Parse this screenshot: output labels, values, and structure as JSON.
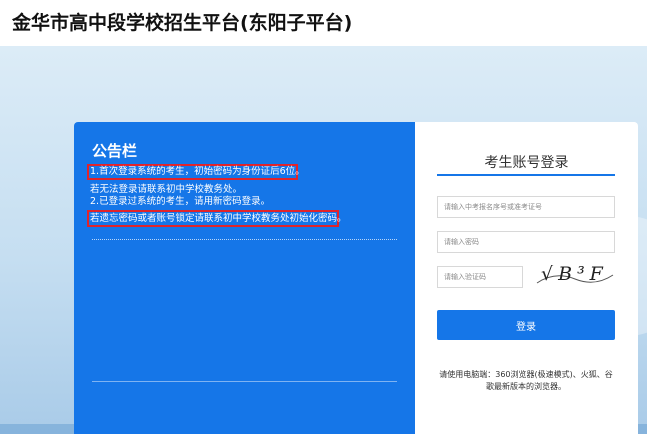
{
  "header": {
    "title": "金华市高中段学校招生平台(东阳子平台)"
  },
  "notice": {
    "title": "公告栏",
    "lines": [
      "1.首次登录系统的考生，初始密码为身份证后6位。",
      "若无法登录请联系初中学校教务处。",
      "2.已登录过系统的考生，请用新密码登录。",
      "若遗忘密码或者账号锁定请联系初中学校教务处初始化密码。"
    ]
  },
  "login": {
    "title": "考生账号登录",
    "account_placeholder": "请输入中考报名序号或准考证号",
    "password_placeholder": "请输入密码",
    "captcha_placeholder": "请输入验证码",
    "captcha_text": "√B³F",
    "button_label": "登录",
    "tip": "请使用电脑端：360浏览器(极速模式)、火狐、谷歌最新版本的浏览器。"
  },
  "colors": {
    "primary": "#1576e8",
    "highlight": "#e0242b",
    "hero_bg": "#c5def1"
  }
}
